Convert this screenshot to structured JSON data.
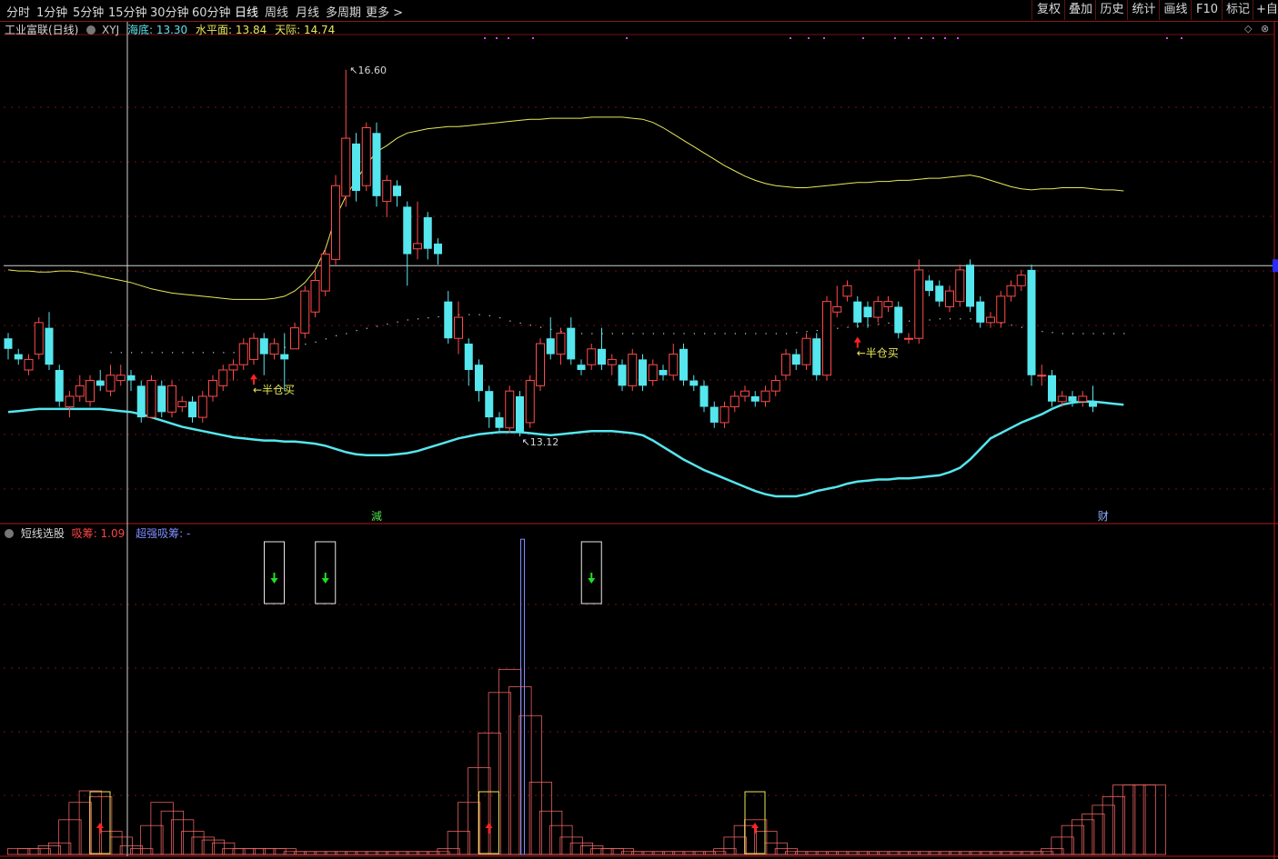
{
  "toolbar": {
    "periods": [
      "分时",
      "1分钟",
      "5分钟",
      "15分钟",
      "30分钟",
      "60分钟",
      "日线",
      "周线",
      "月线",
      "多周期",
      "更多 >"
    ],
    "active_period": "日线",
    "right_tools": [
      "复权",
      "叠加",
      "历史",
      "统计",
      "画线",
      "F10",
      "标记",
      "+自选"
    ]
  },
  "price_panel": {
    "stock_title": "工业富联(日线)",
    "indicator_name": "XYJ",
    "legend": [
      {
        "label": "海底",
        "value": "13.30",
        "color": "#55e6ee"
      },
      {
        "label": "水平面",
        "value": "13.84",
        "color": "#e8e85a"
      },
      {
        "label": "天际",
        "value": "14.74",
        "color": "#e8e85a"
      }
    ],
    "high_label": "16.60",
    "low_label": "13.12",
    "buy_labels": [
      "←半仓买",
      "←半仓买"
    ],
    "bottom_tags": [
      {
        "text": "減",
        "color": "#4ee04e"
      },
      {
        "text": "财",
        "color": "#8fb0ff"
      }
    ]
  },
  "indicator_panel": {
    "name": "短线选股",
    "legend": [
      {
        "label": "吸筹",
        "value": "1.09",
        "color": "#ff4444"
      },
      {
        "label": "超强吸筹",
        "value": "-",
        "color": "#7e8cff"
      }
    ]
  },
  "colors": {
    "up": "#ff4a4a",
    "down": "#55e6ee",
    "bg": "#000000",
    "grid": "#7a1010",
    "yellow_line": "#e8e85a",
    "cyan_line": "#55e6ee",
    "signal_green": "#22dd22",
    "signal_red": "#ff2222",
    "box_yellow": "#e8e85a",
    "strong_bar": "#7e8cff"
  },
  "chart_data": [
    {
      "type": "candlestick",
      "ylim": [
        12.3,
        16.9
      ],
      "y_ref": 14.74,
      "candles": [
        [
          14.05,
          13.95,
          14.1,
          13.85
        ],
        [
          13.9,
          13.85,
          13.95,
          13.8
        ],
        [
          13.75,
          13.85,
          13.9,
          13.7
        ],
        [
          13.9,
          14.2,
          14.25,
          13.85
        ],
        [
          14.15,
          13.8,
          14.3,
          13.75
        ],
        [
          13.75,
          13.45,
          13.8,
          13.4
        ],
        [
          13.4,
          13.5,
          13.55,
          13.3
        ],
        [
          13.5,
          13.6,
          13.7,
          13.45
        ],
        [
          13.45,
          13.65,
          13.7,
          13.4
        ],
        [
          13.65,
          13.6,
          13.75,
          13.55
        ],
        [
          13.55,
          13.7,
          13.8,
          13.5
        ],
        [
          13.65,
          13.7,
          13.8,
          13.6
        ],
        [
          13.7,
          13.65,
          13.75,
          13.55
        ],
        [
          13.6,
          13.3,
          13.65,
          13.25
        ],
        [
          13.3,
          13.65,
          13.7,
          13.3
        ],
        [
          13.6,
          13.35,
          13.65,
          13.3
        ],
        [
          13.35,
          13.6,
          13.65,
          13.3
        ],
        [
          13.4,
          13.45,
          13.5,
          13.35
        ],
        [
          13.45,
          13.3,
          13.5,
          13.25
        ],
        [
          13.3,
          13.5,
          13.55,
          13.25
        ],
        [
          13.5,
          13.65,
          13.7,
          13.45
        ],
        [
          13.6,
          13.75,
          13.8,
          13.55
        ],
        [
          13.75,
          13.8,
          13.85,
          13.65
        ],
        [
          13.8,
          14.0,
          14.05,
          13.75
        ],
        [
          13.85,
          14.05,
          14.1,
          13.8
        ],
        [
          14.05,
          13.9,
          14.1,
          13.7
        ],
        [
          13.9,
          14.0,
          14.05,
          13.85
        ],
        [
          13.9,
          13.85,
          14.1,
          13.55
        ],
        [
          13.95,
          14.15,
          14.2,
          13.95
        ],
        [
          14.1,
          14.5,
          14.55,
          14.05
        ],
        [
          14.3,
          14.6,
          14.7,
          14.25
        ],
        [
          14.5,
          14.85,
          14.9,
          14.45
        ],
        [
          14.8,
          15.5,
          15.6,
          14.75
        ],
        [
          15.4,
          15.95,
          16.6,
          15.3
        ],
        [
          15.9,
          15.45,
          16.0,
          15.35
        ],
        [
          15.5,
          16.05,
          16.1,
          15.45
        ],
        [
          16.0,
          15.4,
          16.1,
          15.3
        ],
        [
          15.35,
          15.55,
          15.6,
          15.2
        ],
        [
          15.5,
          15.4,
          15.55,
          15.3
        ],
        [
          15.3,
          14.85,
          15.35,
          14.55
        ],
        [
          14.9,
          14.95,
          15.35,
          14.8
        ],
        [
          15.2,
          14.9,
          15.25,
          14.8
        ],
        [
          14.95,
          14.85,
          15.0,
          14.75
        ],
        [
          14.4,
          14.05,
          14.5,
          14.0
        ],
        [
          14.05,
          14.25,
          14.4,
          13.9
        ],
        [
          14.0,
          13.75,
          14.05,
          13.6
        ],
        [
          13.8,
          13.55,
          13.85,
          13.45
        ],
        [
          13.55,
          13.3,
          13.6,
          13.2
        ],
        [
          13.3,
          13.2,
          13.35,
          13.15
        ],
        [
          13.2,
          13.55,
          13.6,
          13.15
        ],
        [
          13.5,
          13.15,
          13.55,
          13.12
        ],
        [
          13.25,
          13.65,
          13.7,
          13.2
        ],
        [
          13.6,
          14.0,
          14.05,
          13.55
        ],
        [
          14.05,
          13.9,
          14.25,
          13.85
        ],
        [
          13.9,
          14.1,
          14.15,
          13.8
        ],
        [
          14.15,
          13.85,
          14.25,
          13.8
        ],
        [
          13.8,
          13.75,
          13.85,
          13.7
        ],
        [
          13.8,
          13.95,
          14.0,
          13.75
        ],
        [
          13.95,
          13.8,
          14.15,
          13.75
        ],
        [
          13.8,
          13.85,
          13.9,
          13.7
        ],
        [
          13.8,
          13.6,
          13.85,
          13.55
        ],
        [
          13.6,
          13.9,
          13.95,
          13.55
        ],
        [
          13.85,
          13.6,
          13.9,
          13.55
        ],
        [
          13.65,
          13.8,
          13.85,
          13.6
        ],
        [
          13.75,
          13.7,
          13.8,
          13.65
        ],
        [
          13.7,
          13.9,
          14.0,
          13.65
        ],
        [
          13.95,
          13.65,
          14.0,
          13.6
        ],
        [
          13.65,
          13.6,
          13.7,
          13.55
        ],
        [
          13.6,
          13.4,
          13.65,
          13.35
        ],
        [
          13.4,
          13.25,
          13.45,
          13.2
        ],
        [
          13.25,
          13.4,
          13.45,
          13.2
        ],
        [
          13.4,
          13.5,
          13.55,
          13.35
        ],
        [
          13.5,
          13.55,
          13.6,
          13.45
        ],
        [
          13.5,
          13.45,
          13.55,
          13.4
        ],
        [
          13.45,
          13.55,
          13.6,
          13.4
        ],
        [
          13.55,
          13.65,
          13.7,
          13.5
        ],
        [
          13.7,
          13.9,
          13.95,
          13.65
        ],
        [
          13.9,
          13.8,
          13.95,
          13.75
        ],
        [
          13.8,
          14.05,
          14.1,
          13.75
        ],
        [
          14.05,
          13.7,
          14.1,
          13.65
        ],
        [
          13.7,
          14.4,
          14.45,
          13.65
        ],
        [
          14.3,
          14.35,
          14.55,
          14.25
        ],
        [
          14.45,
          14.55,
          14.6,
          14.4
        ],
        [
          14.4,
          14.2,
          14.45,
          14.15
        ],
        [
          14.35,
          14.25,
          14.4,
          14.15
        ],
        [
          14.25,
          14.4,
          14.45,
          14.2
        ],
        [
          14.35,
          14.4,
          14.45,
          14.3
        ],
        [
          14.35,
          14.1,
          14.4,
          14.05
        ],
        [
          14.05,
          14.05,
          14.1,
          14.0
        ],
        [
          14.05,
          14.7,
          14.8,
          14.0
        ],
        [
          14.6,
          14.5,
          14.65,
          14.45
        ],
        [
          14.55,
          14.4,
          14.6,
          14.35
        ],
        [
          14.35,
          14.5,
          14.55,
          14.3
        ],
        [
          14.4,
          14.7,
          14.75,
          14.35
        ],
        [
          14.75,
          14.35,
          14.8,
          14.3
        ],
        [
          14.4,
          14.2,
          14.45,
          14.15
        ],
        [
          14.2,
          14.25,
          14.3,
          14.15
        ],
        [
          14.2,
          14.45,
          14.5,
          14.15
        ],
        [
          14.45,
          14.55,
          14.6,
          14.4
        ],
        [
          14.55,
          14.65,
          14.7,
          14.5
        ],
        [
          14.7,
          13.7,
          14.75,
          13.6
        ],
        [
          13.7,
          13.7,
          13.8,
          13.6
        ],
        [
          13.7,
          13.45,
          13.75,
          13.4
        ],
        [
          13.45,
          13.5,
          13.55,
          13.4
        ],
        [
          13.5,
          13.45,
          13.55,
          13.4
        ],
        [
          13.45,
          13.5,
          13.55,
          13.4
        ],
        [
          13.45,
          13.4,
          13.6,
          13.35
        ]
      ],
      "tianji_line": [
        14.7,
        14.69,
        14.69,
        14.68,
        14.68,
        14.69,
        14.69,
        14.68,
        14.66,
        14.64,
        14.62,
        14.6,
        14.58,
        14.55,
        14.52,
        14.5,
        14.48,
        14.47,
        14.46,
        14.45,
        14.44,
        14.43,
        14.42,
        14.42,
        14.42,
        14.42,
        14.43,
        14.45,
        14.5,
        14.58,
        14.7,
        14.9,
        15.2,
        15.4,
        15.55,
        15.7,
        15.82,
        15.88,
        15.95,
        16.0,
        16.02,
        16.04,
        16.05,
        16.06,
        16.06,
        16.07,
        16.08,
        16.09,
        16.1,
        16.11,
        16.12,
        16.13,
        16.13,
        16.14,
        16.14,
        16.14,
        16.14,
        16.15,
        16.15,
        16.15,
        16.15,
        16.14,
        16.13,
        16.1,
        16.05,
        15.99,
        15.93,
        15.87,
        15.81,
        15.75,
        15.69,
        15.64,
        15.59,
        15.55,
        15.52,
        15.5,
        15.49,
        15.48,
        15.48,
        15.49,
        15.5,
        15.51,
        15.52,
        15.53,
        15.53,
        15.54,
        15.54,
        15.55,
        15.55,
        15.56,
        15.57,
        15.57,
        15.58,
        15.59,
        15.6,
        15.58,
        15.55,
        15.52,
        15.49,
        15.47,
        15.46,
        15.47,
        15.47,
        15.48,
        15.48,
        15.48,
        15.47,
        15.46,
        15.46,
        15.45
      ],
      "shuiping_line": [
        null,
        null,
        null,
        null,
        null,
        null,
        null,
        null,
        null,
        null,
        13.92,
        13.92,
        13.92,
        13.92,
        13.92,
        13.92,
        13.92,
        13.92,
        13.92,
        13.92,
        13.92,
        13.92,
        13.92,
        13.93,
        13.94,
        13.95,
        13.96,
        13.97,
        13.98,
        14.0,
        14.02,
        14.05,
        14.08,
        14.1,
        14.13,
        14.15,
        14.17,
        14.19,
        14.21,
        14.23,
        14.24,
        14.25,
        14.26,
        14.27,
        14.28,
        14.28,
        14.28,
        14.27,
        14.25,
        14.22,
        14.2,
        14.18,
        14.16,
        14.14,
        14.12,
        14.11,
        14.1,
        14.1,
        14.1,
        14.1,
        14.1,
        14.1,
        14.1,
        14.1,
        14.1,
        14.1,
        14.1,
        14.1,
        14.1,
        14.1,
        14.1,
        14.1,
        14.1,
        14.1,
        14.1,
        14.1,
        14.1,
        14.11,
        14.12,
        14.13,
        14.14,
        14.15,
        14.16,
        14.17,
        14.18,
        14.19,
        14.2,
        14.21,
        14.22,
        14.23,
        14.23,
        14.24,
        14.24,
        14.24,
        14.24,
        14.23,
        14.22,
        14.2,
        14.18,
        14.16,
        14.14,
        14.12,
        14.11,
        14.1,
        14.1,
        14.1,
        14.1,
        14.1,
        14.1,
        14.1
      ],
      "haidi_line": [
        13.35,
        13.36,
        13.37,
        13.38,
        13.38,
        13.38,
        13.38,
        13.38,
        13.38,
        13.38,
        13.37,
        13.36,
        13.35,
        13.33,
        13.3,
        13.27,
        13.24,
        13.21,
        13.19,
        13.17,
        13.15,
        13.13,
        13.11,
        13.1,
        13.09,
        13.08,
        13.08,
        13.07,
        13.07,
        13.06,
        13.05,
        13.03,
        13.0,
        12.97,
        12.95,
        12.94,
        12.94,
        12.94,
        12.95,
        12.96,
        12.98,
        13.01,
        13.04,
        13.07,
        13.1,
        13.12,
        13.14,
        13.15,
        13.16,
        13.16,
        13.16,
        13.15,
        13.14,
        13.13,
        13.14,
        13.15,
        13.16,
        13.17,
        13.17,
        13.17,
        13.16,
        13.15,
        13.13,
        13.08,
        13.02,
        12.96,
        12.9,
        12.85,
        12.8,
        12.76,
        12.72,
        12.68,
        12.64,
        12.6,
        12.57,
        12.55,
        12.55,
        12.55,
        12.57,
        12.6,
        12.62,
        12.64,
        12.67,
        12.69,
        12.7,
        12.71,
        12.71,
        12.72,
        12.72,
        12.73,
        12.74,
        12.75,
        12.78,
        12.82,
        12.9,
        13.0,
        13.1,
        13.15,
        13.2,
        13.25,
        13.29,
        13.33,
        13.38,
        13.42,
        13.44,
        13.45,
        13.45,
        13.44,
        13.43,
        13.42
      ],
      "buy_marks": [
        24,
        83
      ],
      "high_index": 33,
      "low_index": 50,
      "tag_index": [
        36,
        107
      ]
    },
    {
      "type": "bar",
      "ylim": [
        0,
        1.1
      ],
      "xichou": [
        0.02,
        0.02,
        0.02,
        0.03,
        0.04,
        0.12,
        0.18,
        0.22,
        0.2,
        0.08,
        0.06,
        0.03,
        0.02,
        0.1,
        0.18,
        0.15,
        0.12,
        0.08,
        0.06,
        0.05,
        0.04,
        0.02,
        0.02,
        0.02,
        0.02,
        0.02,
        0.02,
        0.01,
        0.01,
        0.01,
        0.01,
        0.01,
        0.01,
        0.01,
        0.01,
        0.01,
        0.01,
        0.01,
        0.01,
        0.01,
        0.01,
        0.01,
        0.02,
        0.08,
        0.18,
        0.3,
        0.42,
        0.56,
        0.64,
        0.58,
        0.48,
        0.25,
        0.15,
        0.1,
        0.06,
        0.04,
        0.03,
        0.02,
        0.02,
        0.02,
        0.01,
        0.01,
        0.01,
        0.01,
        0.01,
        0.01,
        0.01,
        0.01,
        0.01,
        0.02,
        0.06,
        0.1,
        0.12,
        0.08,
        0.04,
        0.02,
        0.01,
        0.01,
        0.01,
        0.01,
        0.01,
        0.01,
        0.01,
        0.01,
        0.01,
        0.01,
        0.01,
        0.01,
        0.01,
        0.01,
        0.01,
        0.01,
        0.01,
        0.01,
        0.01,
        0.01,
        0.01,
        0.01,
        0.01,
        0.01,
        0.01,
        0.02,
        0.06,
        0.1,
        0.12,
        0.14,
        0.17,
        0.2,
        0.24,
        0.24,
        0.24,
        0.24
      ],
      "strong_bar": {
        "index": 50,
        "value": 1.09
      },
      "down_signals": [
        26,
        31,
        57
      ],
      "up_boxes": [
        8,
        46,
        72
      ]
    }
  ]
}
